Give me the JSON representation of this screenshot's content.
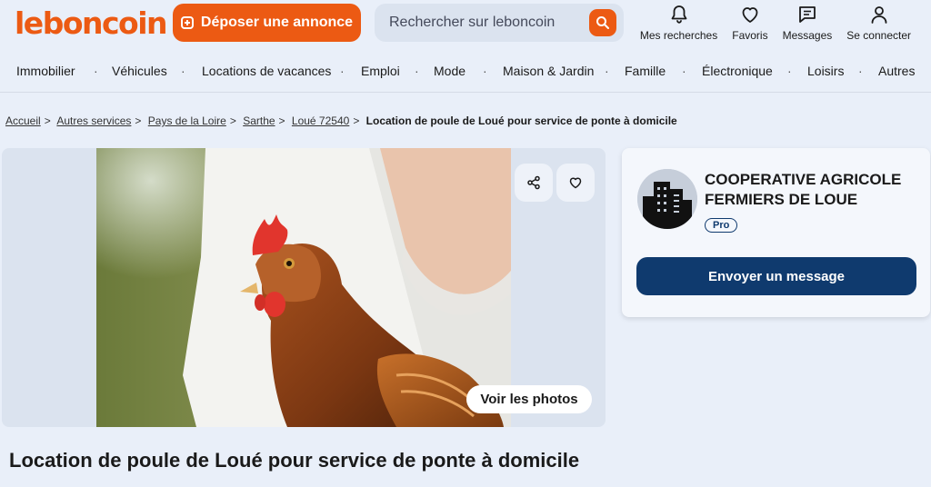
{
  "header": {
    "logo": "leboncoin",
    "post_button": "Déposer une annonce",
    "search_placeholder": "Rechercher sur leboncoin",
    "nav": [
      {
        "label": "Mes recherches",
        "icon": "bell-icon"
      },
      {
        "label": "Favoris",
        "icon": "heart-icon"
      },
      {
        "label": "Messages",
        "icon": "message-icon"
      },
      {
        "label": "Se connecter",
        "icon": "user-icon"
      }
    ],
    "categories": [
      "Immobilier",
      "Véhicules",
      "Locations de vacances",
      "Emploi",
      "Mode",
      "Maison & Jardin",
      "Famille",
      "Électronique",
      "Loisirs",
      "Autres"
    ]
  },
  "breadcrumb": {
    "links": [
      "Accueil",
      "Autres services",
      "Pays de la Loire",
      "Sarthe",
      "Loué 72540"
    ],
    "current": "Location de poule de Loué pour service de ponte à domicile"
  },
  "gallery": {
    "see_photos": "Voir les photos"
  },
  "seller": {
    "name": "COOPERATIVE AGRICOLE FERMIERS DE LOUE",
    "badge": "Pro",
    "message_button": "Envoyer un message"
  },
  "ad": {
    "title": "Location de poule de Loué pour service de ponte à domicile"
  },
  "colors": {
    "brand_orange": "#ec5a13",
    "navy": "#0f3a6e",
    "background": "#e9eff9"
  }
}
